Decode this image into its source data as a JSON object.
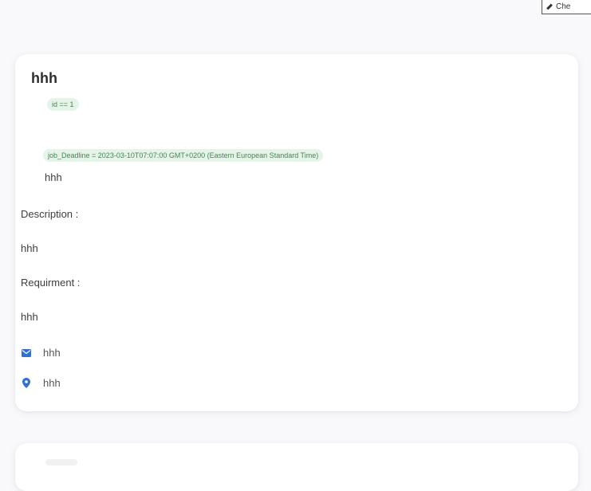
{
  "top_button": {
    "label": "Che"
  },
  "job_card": {
    "title": "hhh",
    "id_chip": "id == 1",
    "deadline_chip": "job_Deadline = 2023-03-10T07:07:00 GMT+0200 (Eastern European Standard Time)",
    "subtitle": "hhh",
    "description_label": "Description :",
    "description_value": "hhh",
    "requirement_label": "Requirment :",
    "requirement_value": "hhh",
    "email": {
      "icon": "mail-icon",
      "value": "hhh"
    },
    "location": {
      "icon": "location-pin-icon",
      "value": "hhh"
    }
  },
  "colors": {
    "accent_blue": "#2f6fd6",
    "chip_green_text": "#3f8a50",
    "chip_green_bg": "#e6f3e8"
  }
}
